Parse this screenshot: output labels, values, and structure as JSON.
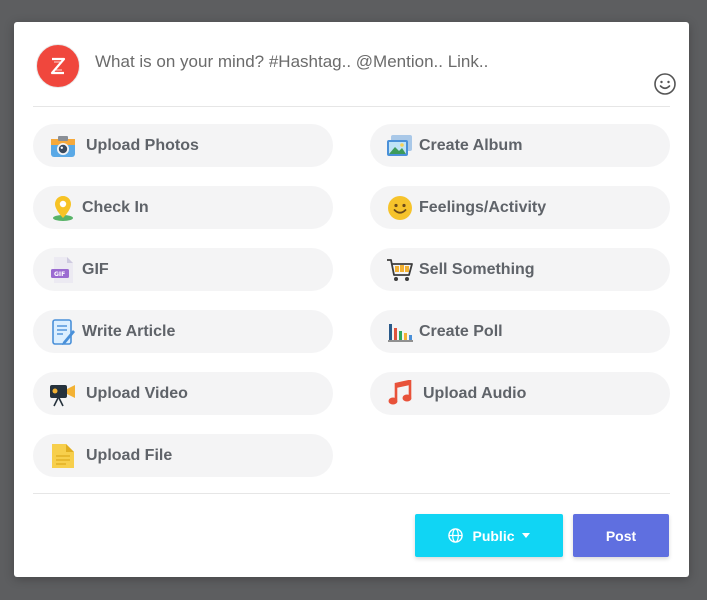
{
  "composer": {
    "placeholder": "What is on your mind? #Hashtag.. @Mention.. Link..",
    "avatar_color": "#f0473d"
  },
  "options": [
    {
      "label": "Upload Photos",
      "icon": "camera-icon"
    },
    {
      "label": "Create Album",
      "icon": "album-icon"
    },
    {
      "label": "Check In",
      "icon": "location-pin-icon"
    },
    {
      "label": "Feelings/Activity",
      "icon": "smiley-face-icon"
    },
    {
      "label": "GIF",
      "icon": "gif-file-icon"
    },
    {
      "label": "Sell Something",
      "icon": "shopping-cart-icon"
    },
    {
      "label": "Write Article",
      "icon": "article-icon"
    },
    {
      "label": "Create Poll",
      "icon": "bar-chart-icon"
    },
    {
      "label": "Upload Video",
      "icon": "video-camera-icon"
    },
    {
      "label": "Upload Audio",
      "icon": "music-note-icon"
    },
    {
      "label": "Upload File",
      "icon": "file-icon"
    }
  ],
  "footer": {
    "privacy_label": "Public",
    "post_label": "Post"
  },
  "colors": {
    "privacy_button": "#10d5f4",
    "post_button": "#5f6fe0",
    "option_bg": "#f4f4f5"
  }
}
